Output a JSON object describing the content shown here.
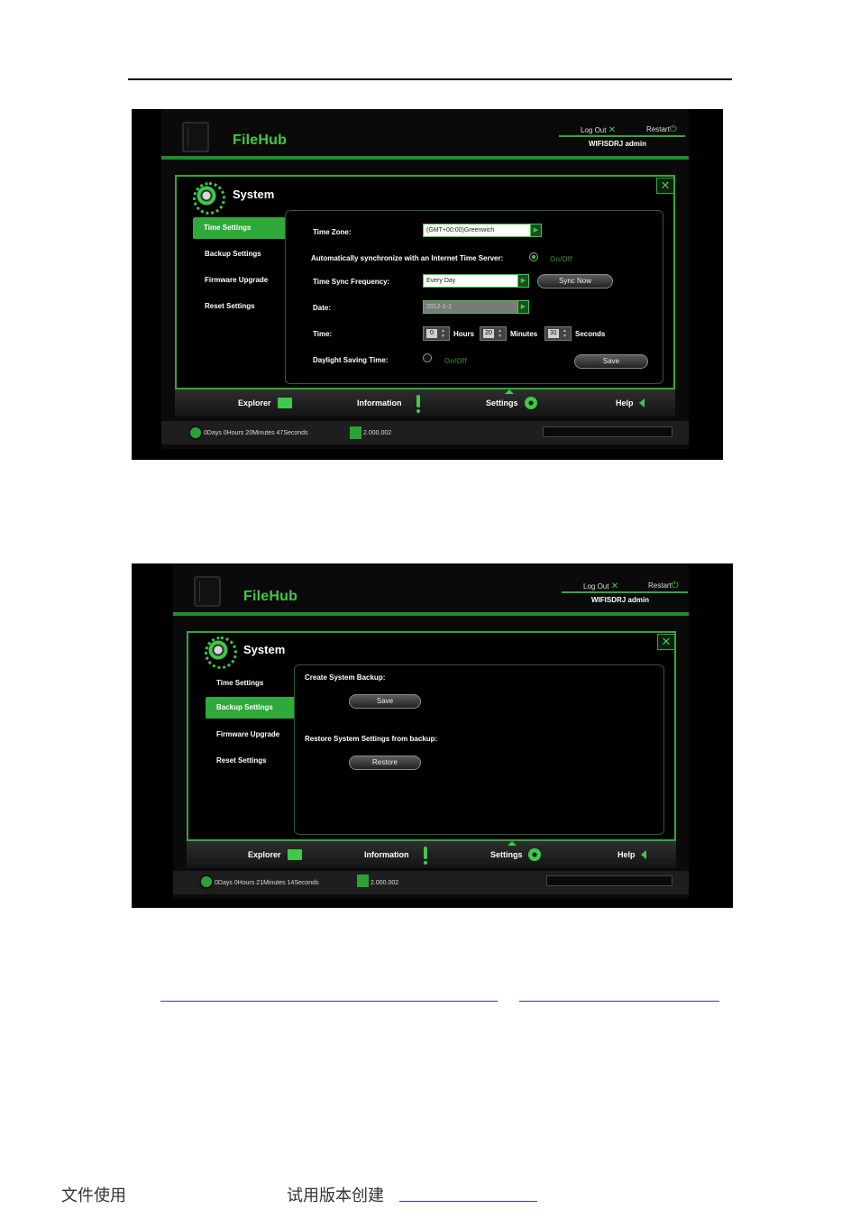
{
  "screen1": {
    "brand": "FileHub",
    "logout": "Log Out",
    "restart": "Restart",
    "user_line": "WIFISDRJ   admin",
    "system_title": "System",
    "sidebar": [
      "Time Settings",
      "Backup Settings",
      "Firmware Upgrade",
      "Reset Settings"
    ],
    "active_item": "Time Settings",
    "time_zone_label": "Time Zone:",
    "time_zone_value": "(GMT+00:00)Greenwich",
    "auto_sync_label": "Automatically synchronize with an Internet Time Server:",
    "auto_sync_onoff": "On/Off",
    "freq_label": "Time Sync Frequency:",
    "freq_value": "Every Day",
    "sync_now": "Sync Now",
    "date_label": "Date:",
    "date_value": "2012-1-1",
    "time_label": "Time:",
    "hours_value": "0",
    "hours_label": "Hours",
    "minutes_value": "20",
    "minutes_label": "Minutes",
    "seconds_value": "31",
    "seconds_label": "Seconds",
    "dst_label": "Daylight Saving Time:",
    "dst_onoff": "On/Off",
    "save": "Save",
    "nav": [
      "Explorer",
      "Information",
      "Settings",
      "Help"
    ],
    "uptime": "0Days 0Hours 20Minutes 47Seconds",
    "version": "2.000.002"
  },
  "screen2": {
    "brand": "FileHub",
    "logout": "Log Out",
    "restart": "Restart",
    "user_line": "WIFISDRJ   admin",
    "system_title": "System",
    "sidebar": [
      "Time Settings",
      "Backup Settings",
      "Firmware Upgrade",
      "Reset Settings"
    ],
    "active_item": "Backup Settings",
    "create_label": "Create System Backup:",
    "save": "Save",
    "restore_label": "Restore System Settings from backup:",
    "restore": "Restore",
    "nav": [
      "Explorer",
      "Information",
      "Settings",
      "Help"
    ],
    "uptime": "0Days 0Hours 21Minutes 14Seconds",
    "version": "2.000.002"
  },
  "footer": {
    "left": "文件使用",
    "middle": "试用版本创建"
  },
  "colors": {
    "accent": "#3fc94a",
    "panel_border": "#2eaa38",
    "background": "#000000"
  }
}
